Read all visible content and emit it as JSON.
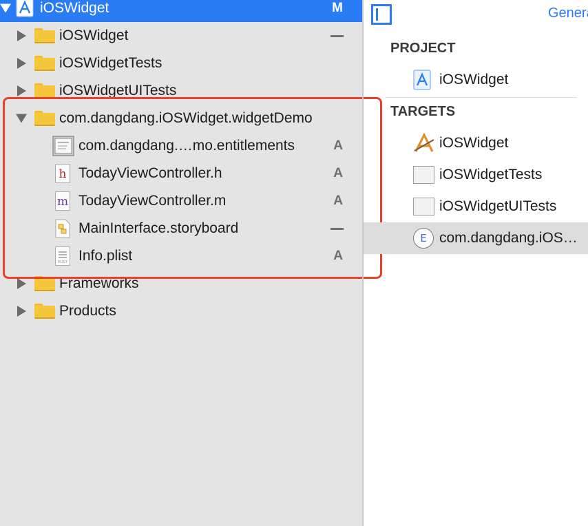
{
  "navigator": {
    "root": {
      "label": "iOSWidget",
      "badge": "M"
    },
    "items": [
      {
        "label": "iOSWidget",
        "badge": "—"
      },
      {
        "label": "iOSWidgetTests",
        "badge": ""
      },
      {
        "label": "iOSWidgetUITests",
        "badge": ""
      },
      {
        "label": "com.dangdang.iOSWidget.widgetDemo",
        "badge": ""
      },
      {
        "label": "com.dangdang.…mo.entitlements",
        "badge": "A"
      },
      {
        "label": "TodayViewController.h",
        "badge": "A"
      },
      {
        "label": "TodayViewController.m",
        "badge": "A"
      },
      {
        "label": "MainInterface.storyboard",
        "badge": "—"
      },
      {
        "label": "Info.plist",
        "badge": "A"
      },
      {
        "label": "Frameworks",
        "badge": ""
      },
      {
        "label": "Products",
        "badge": ""
      }
    ],
    "glyphs": {
      "h": "h",
      "m": "m",
      "plist": "PLIST"
    }
  },
  "editor": {
    "tab_label": "General",
    "project_header": "PROJECT",
    "project_item": "iOSWidget",
    "targets_header": "TARGETS",
    "targets": [
      {
        "label": "iOSWidget"
      },
      {
        "label": "iOSWidgetTests"
      },
      {
        "label": "iOSWidgetUITests"
      },
      {
        "label": "com.dangdang.iOS…",
        "icon_letter": "E"
      }
    ]
  },
  "colors": {
    "selection": "#2a7cf5",
    "highlight_box": "#e8412c",
    "folder": "#f7c73b"
  }
}
